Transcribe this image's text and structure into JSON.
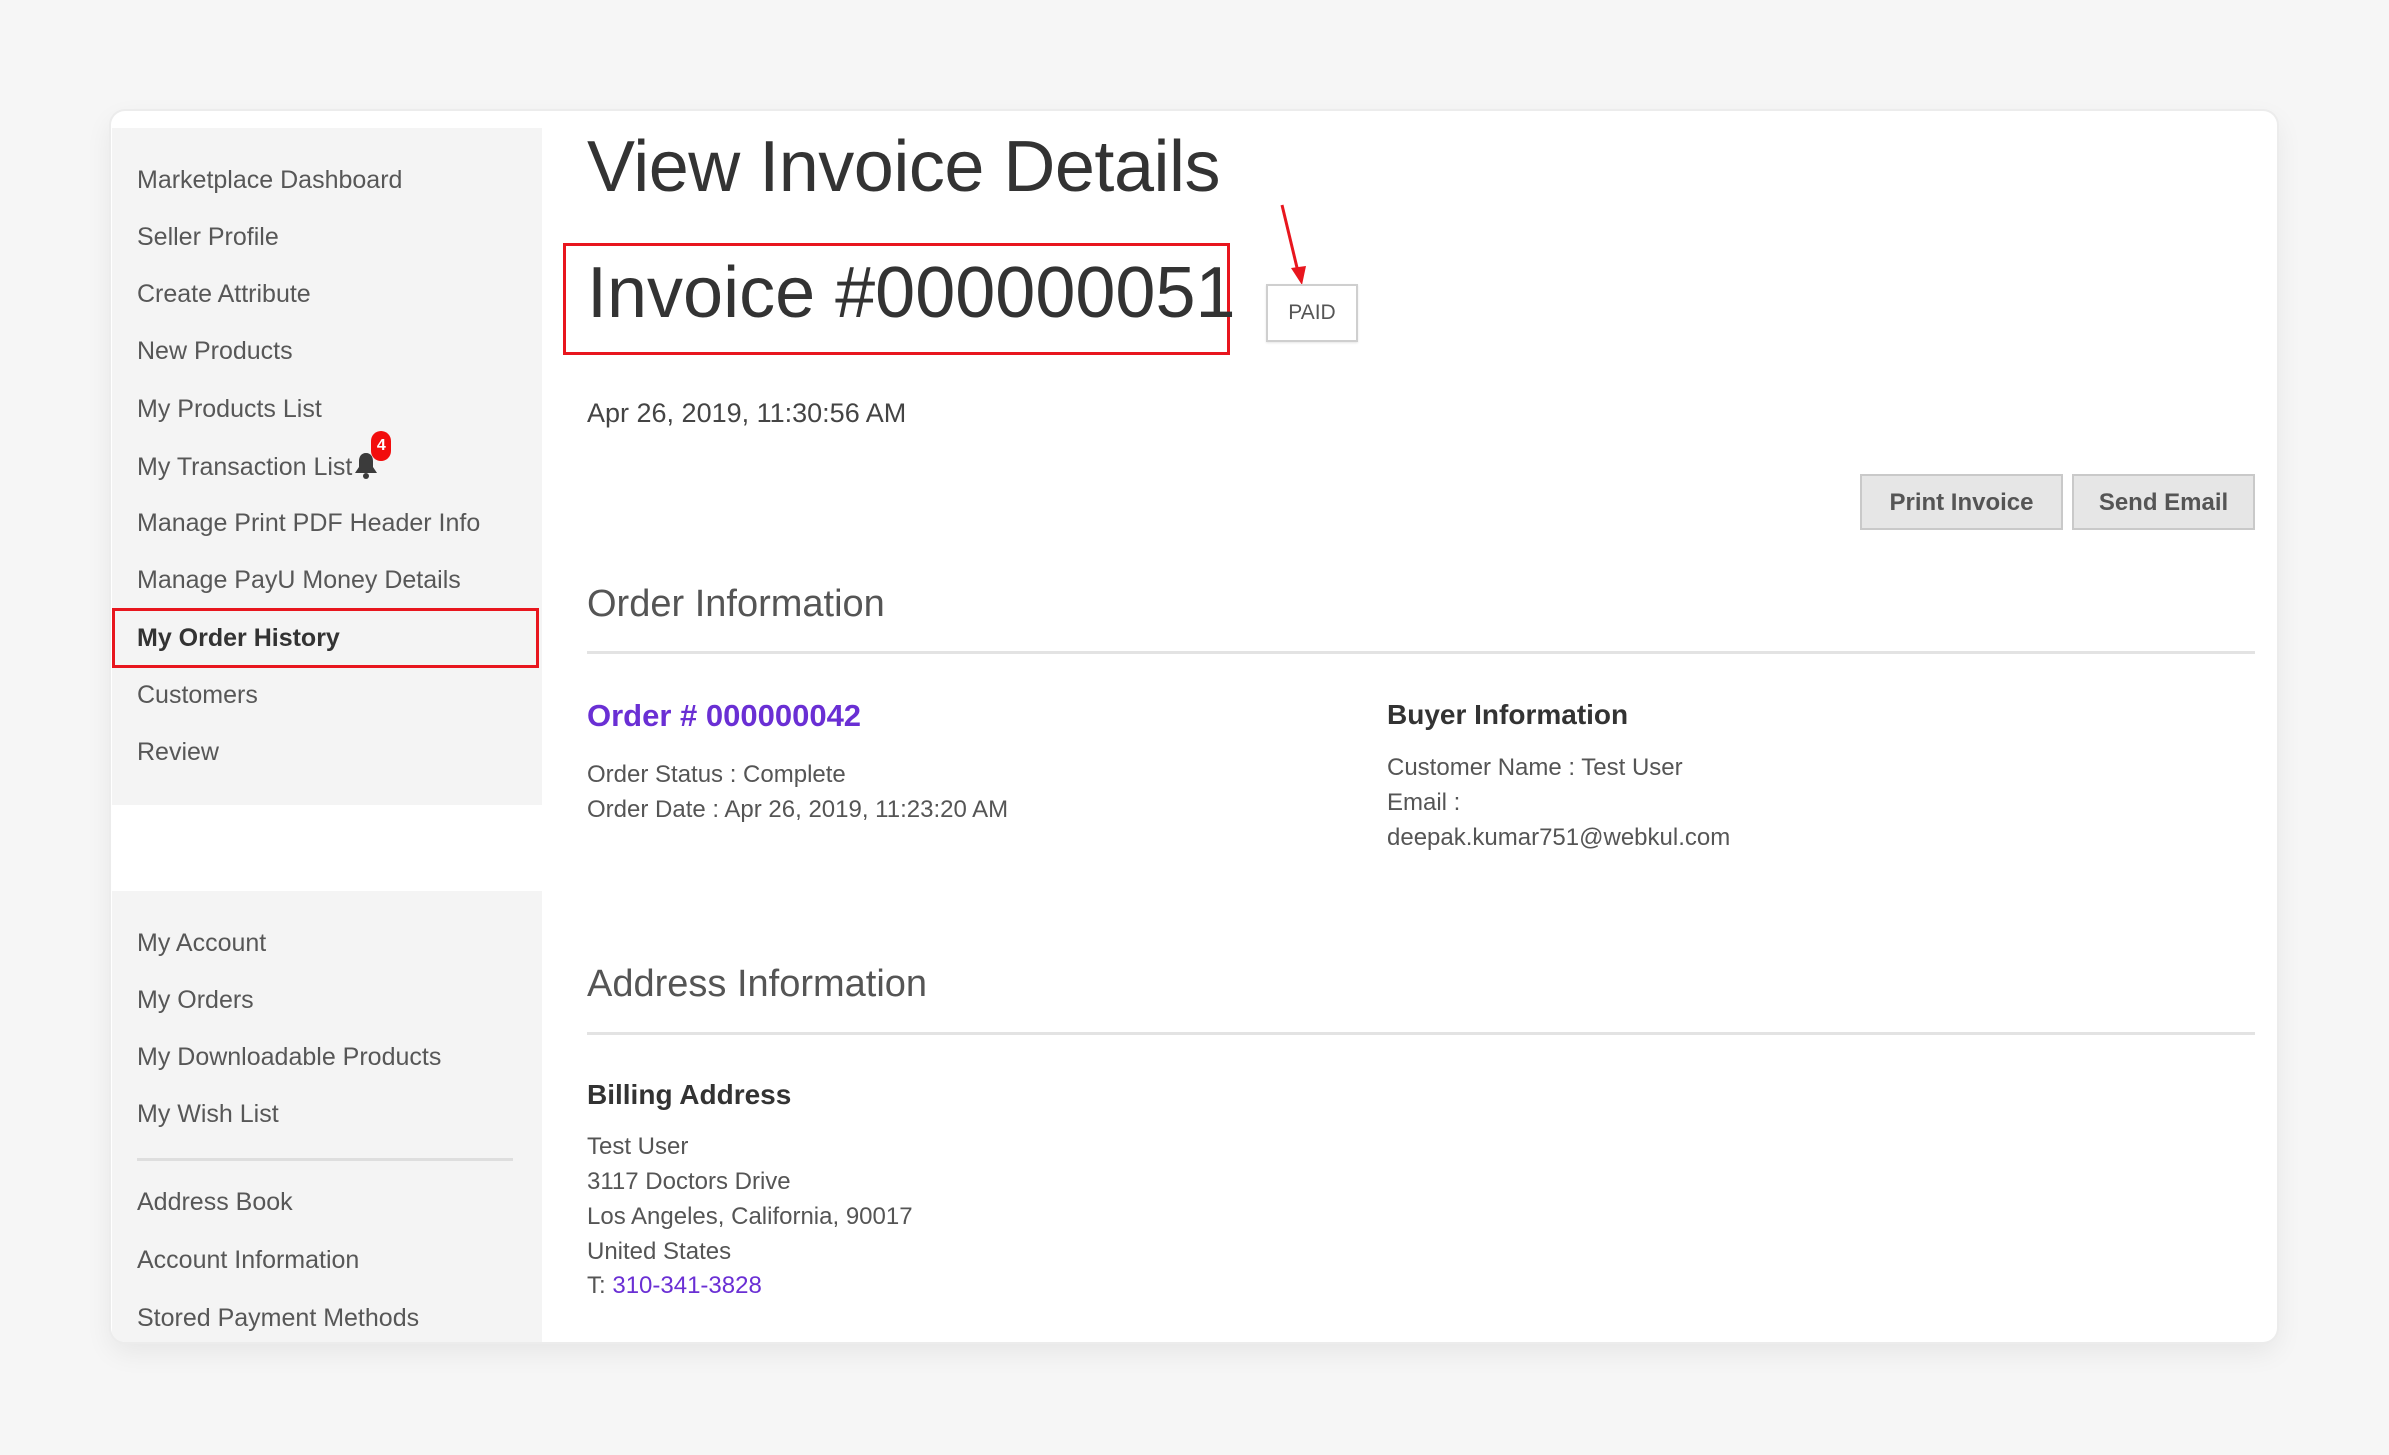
{
  "sidebar": {
    "seller_items": [
      {
        "label": "Marketplace Dashboard"
      },
      {
        "label": "Seller Profile"
      },
      {
        "label": "Create Attribute"
      },
      {
        "label": "New Products"
      },
      {
        "label": "My Products List"
      },
      {
        "label": "My Transaction List",
        "notification_count": "4",
        "icon": "bell-icon"
      },
      {
        "label": "Manage Print PDF Header Info"
      },
      {
        "label": "Manage PayU Money Details"
      },
      {
        "label": "My Order History",
        "active": true
      },
      {
        "label": "Customers"
      },
      {
        "label": "Review"
      }
    ],
    "account_items": [
      {
        "label": "My Account"
      },
      {
        "label": "My Orders"
      },
      {
        "label": "My Downloadable Products"
      },
      {
        "label": "My Wish List"
      }
    ],
    "account_items_2": [
      {
        "label": "Address Book"
      },
      {
        "label": "Account Information"
      },
      {
        "label": "Stored Payment Methods"
      }
    ]
  },
  "main": {
    "page_title": "View Invoice Details",
    "invoice_title": "Invoice #000000051",
    "status_badge": "PAID",
    "invoice_date": "Apr 26, 2019, 11:30:56 AM",
    "actions": {
      "print_label": "Print Invoice",
      "email_label": "Send Email"
    },
    "order_information": {
      "heading": "Order Information",
      "order_link": "Order # 000000042",
      "order_status": "Order Status : Complete",
      "order_date": "Order Date : Apr 26, 2019, 11:23:20 AM",
      "buyer": {
        "heading": "Buyer Information",
        "customer_name": "Customer Name : Test User",
        "email_label": "Email :",
        "email": "deepak.kumar751@webkul.com"
      }
    },
    "address_information": {
      "heading": "Address Information",
      "billing": {
        "heading": "Billing Address",
        "name": "Test User",
        "street": "3117 Doctors Drive",
        "city_line": "Los Angeles, California, 90017",
        "country": "United States",
        "phone_prefix": "T:",
        "phone": "310-341-3828"
      }
    }
  },
  "colors": {
    "accent_link": "#6a2fd4",
    "annotation_red": "#e8161e",
    "badge_red": "#f20d0d"
  }
}
